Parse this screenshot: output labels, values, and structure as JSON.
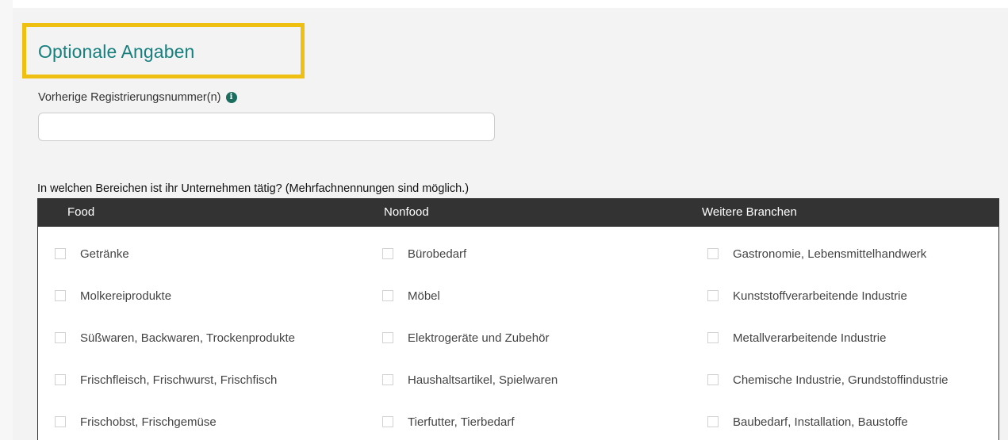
{
  "section_title": "Optionale Angaben",
  "registration": {
    "label": "Vorherige Registrierungsnummer(n)",
    "value": ""
  },
  "question": "In welchen Bereichen ist ihr Unternehmen tätig? (Mehrfachnennungen sind möglich.)",
  "columns": [
    {
      "header": "Food",
      "items": [
        {
          "label": "Getränke",
          "checked": false
        },
        {
          "label": "Molkereiprodukte",
          "checked": false
        },
        {
          "label": "Süßwaren, Backwaren, Trockenprodukte",
          "checked": false
        },
        {
          "label": "Frischfleisch, Frischwurst, Frischfisch",
          "checked": false
        },
        {
          "label": "Frischobst, Frischgemüse",
          "checked": false
        }
      ]
    },
    {
      "header": "Nonfood",
      "items": [
        {
          "label": "Bürobedarf",
          "checked": false
        },
        {
          "label": "Möbel",
          "checked": false
        },
        {
          "label": "Elektrogeräte und Zubehör",
          "checked": false
        },
        {
          "label": "Haushaltsartikel, Spielwaren",
          "checked": false
        },
        {
          "label": "Tierfutter, Tierbedarf",
          "checked": false
        }
      ]
    },
    {
      "header": "Weitere Branchen",
      "items": [
        {
          "label": "Gastronomie, Lebensmittelhandwerk",
          "checked": false
        },
        {
          "label": "Kunststoffverarbeitende Industrie",
          "checked": false
        },
        {
          "label": "Metallverarbeitende Industrie",
          "checked": false
        },
        {
          "label": "Chemische Industrie, Grundstoffindustrie",
          "checked": false
        },
        {
          "label": "Baubedarf, Installation, Baustoffe",
          "checked": false
        }
      ]
    }
  ],
  "colors": {
    "title": "#17807e",
    "highlight_border": "#efbf12",
    "header_bg": "#333333",
    "info_icon": "#1b6e5f"
  }
}
